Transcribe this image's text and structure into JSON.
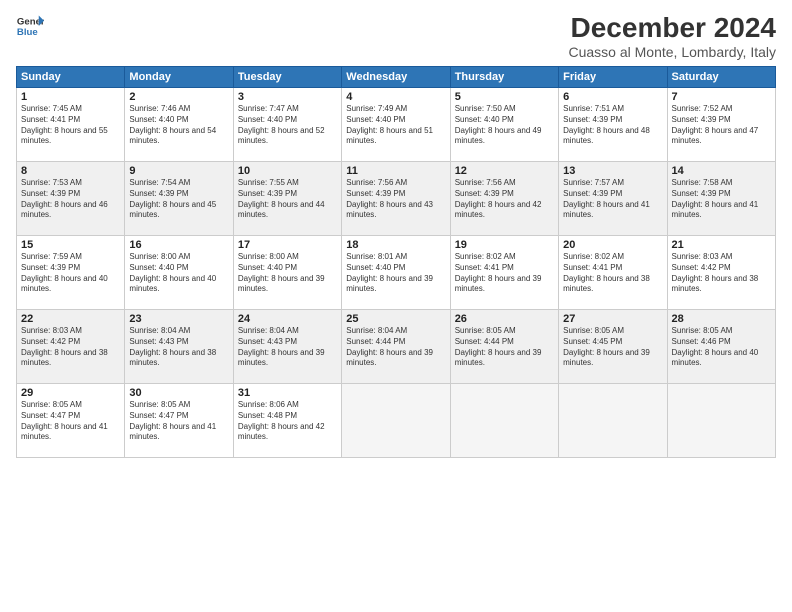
{
  "logo": {
    "line1": "General",
    "line2": "Blue"
  },
  "title": "December 2024",
  "location": "Cuasso al Monte, Lombardy, Italy",
  "days_of_week": [
    "Sunday",
    "Monday",
    "Tuesday",
    "Wednesday",
    "Thursday",
    "Friday",
    "Saturday"
  ],
  "cells": [
    [
      {
        "day": "1",
        "sunrise": "7:45 AM",
        "sunset": "4:41 PM",
        "daylight": "8 hours and 55 minutes."
      },
      {
        "day": "2",
        "sunrise": "7:46 AM",
        "sunset": "4:40 PM",
        "daylight": "8 hours and 54 minutes."
      },
      {
        "day": "3",
        "sunrise": "7:47 AM",
        "sunset": "4:40 PM",
        "daylight": "8 hours and 52 minutes."
      },
      {
        "day": "4",
        "sunrise": "7:49 AM",
        "sunset": "4:40 PM",
        "daylight": "8 hours and 51 minutes."
      },
      {
        "day": "5",
        "sunrise": "7:50 AM",
        "sunset": "4:40 PM",
        "daylight": "8 hours and 49 minutes."
      },
      {
        "day": "6",
        "sunrise": "7:51 AM",
        "sunset": "4:39 PM",
        "daylight": "8 hours and 48 minutes."
      },
      {
        "day": "7",
        "sunrise": "7:52 AM",
        "sunset": "4:39 PM",
        "daylight": "8 hours and 47 minutes."
      }
    ],
    [
      {
        "day": "8",
        "sunrise": "7:53 AM",
        "sunset": "4:39 PM",
        "daylight": "8 hours and 46 minutes."
      },
      {
        "day": "9",
        "sunrise": "7:54 AM",
        "sunset": "4:39 PM",
        "daylight": "8 hours and 45 minutes."
      },
      {
        "day": "10",
        "sunrise": "7:55 AM",
        "sunset": "4:39 PM",
        "daylight": "8 hours and 44 minutes."
      },
      {
        "day": "11",
        "sunrise": "7:56 AM",
        "sunset": "4:39 PM",
        "daylight": "8 hours and 43 minutes."
      },
      {
        "day": "12",
        "sunrise": "7:56 AM",
        "sunset": "4:39 PM",
        "daylight": "8 hours and 42 minutes."
      },
      {
        "day": "13",
        "sunrise": "7:57 AM",
        "sunset": "4:39 PM",
        "daylight": "8 hours and 41 minutes."
      },
      {
        "day": "14",
        "sunrise": "7:58 AM",
        "sunset": "4:39 PM",
        "daylight": "8 hours and 41 minutes."
      }
    ],
    [
      {
        "day": "15",
        "sunrise": "7:59 AM",
        "sunset": "4:39 PM",
        "daylight": "8 hours and 40 minutes."
      },
      {
        "day": "16",
        "sunrise": "8:00 AM",
        "sunset": "4:40 PM",
        "daylight": "8 hours and 40 minutes."
      },
      {
        "day": "17",
        "sunrise": "8:00 AM",
        "sunset": "4:40 PM",
        "daylight": "8 hours and 39 minutes."
      },
      {
        "day": "18",
        "sunrise": "8:01 AM",
        "sunset": "4:40 PM",
        "daylight": "8 hours and 39 minutes."
      },
      {
        "day": "19",
        "sunrise": "8:02 AM",
        "sunset": "4:41 PM",
        "daylight": "8 hours and 39 minutes."
      },
      {
        "day": "20",
        "sunrise": "8:02 AM",
        "sunset": "4:41 PM",
        "daylight": "8 hours and 38 minutes."
      },
      {
        "day": "21",
        "sunrise": "8:03 AM",
        "sunset": "4:42 PM",
        "daylight": "8 hours and 38 minutes."
      }
    ],
    [
      {
        "day": "22",
        "sunrise": "8:03 AM",
        "sunset": "4:42 PM",
        "daylight": "8 hours and 38 minutes."
      },
      {
        "day": "23",
        "sunrise": "8:04 AM",
        "sunset": "4:43 PM",
        "daylight": "8 hours and 38 minutes."
      },
      {
        "day": "24",
        "sunrise": "8:04 AM",
        "sunset": "4:43 PM",
        "daylight": "8 hours and 39 minutes."
      },
      {
        "day": "25",
        "sunrise": "8:04 AM",
        "sunset": "4:44 PM",
        "daylight": "8 hours and 39 minutes."
      },
      {
        "day": "26",
        "sunrise": "8:05 AM",
        "sunset": "4:44 PM",
        "daylight": "8 hours and 39 minutes."
      },
      {
        "day": "27",
        "sunrise": "8:05 AM",
        "sunset": "4:45 PM",
        "daylight": "8 hours and 39 minutes."
      },
      {
        "day": "28",
        "sunrise": "8:05 AM",
        "sunset": "4:46 PM",
        "daylight": "8 hours and 40 minutes."
      }
    ],
    [
      {
        "day": "29",
        "sunrise": "8:05 AM",
        "sunset": "4:47 PM",
        "daylight": "8 hours and 41 minutes."
      },
      {
        "day": "30",
        "sunrise": "8:05 AM",
        "sunset": "4:47 PM",
        "daylight": "8 hours and 41 minutes."
      },
      {
        "day": "31",
        "sunrise": "8:06 AM",
        "sunset": "4:48 PM",
        "daylight": "8 hours and 42 minutes."
      },
      null,
      null,
      null,
      null
    ]
  ]
}
